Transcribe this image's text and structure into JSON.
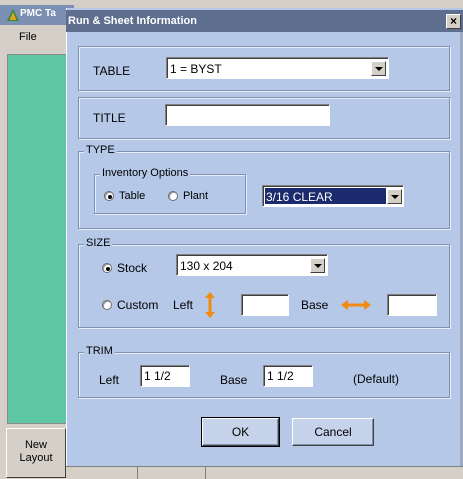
{
  "background_app": {
    "title": "PMC Ta",
    "menu_file": "File",
    "new_layout_label_line1": "New",
    "new_layout_label_line2": "Layout",
    "green_color": "#5fc6a3"
  },
  "dialog": {
    "title": "Run & Sheet Information",
    "close_glyph": "×",
    "title_color": "#5d6e8f",
    "body_color": "#b6c8e8",
    "table": {
      "label": "TABLE",
      "value": "1 = BYST"
    },
    "title_field": {
      "label": "TITLE",
      "value": ""
    },
    "type": {
      "group_label": "TYPE",
      "inventory_group_label": "Inventory Options",
      "option_table": "Table",
      "option_plant": "Plant",
      "selected": "Table",
      "material_value": "3/16  CLEAR",
      "material_selected_color": "#1a2a6c"
    },
    "size": {
      "group_label": "SIZE",
      "option_stock": "Stock",
      "stock_value": "130 x 204",
      "option_custom": "Custom",
      "selected": "Stock",
      "left_label": "Left",
      "base_label": "Base",
      "left_value": "",
      "base_value": "",
      "arrow_color": "#f28a10",
      "left_arrow_icon": "vertical-arrow-icon",
      "base_arrow_icon": "horizontal-arrow-icon"
    },
    "trim": {
      "group_label": "TRIM",
      "left_label": "Left",
      "left_value": "1  1/2",
      "base_label": "Base",
      "base_value": "1  1/2",
      "default_note": "(Default)"
    },
    "ok_label": "OK",
    "cancel_label": "Cancel"
  }
}
